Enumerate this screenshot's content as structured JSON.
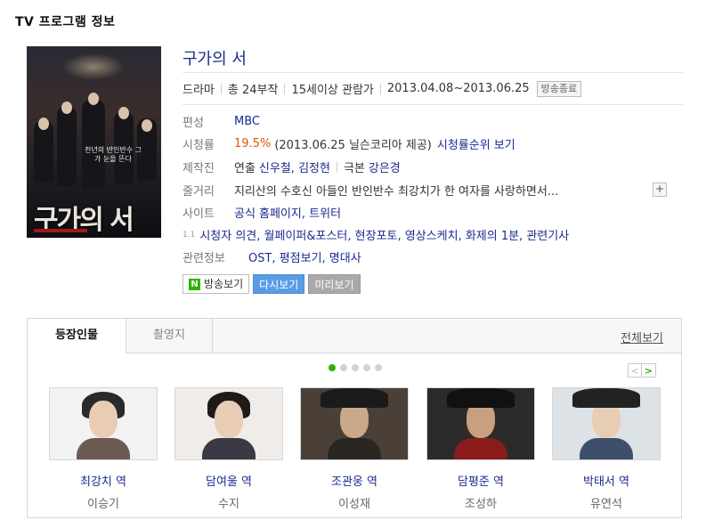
{
  "section_title": "TV 프로그램 정보",
  "poster": {
    "tagline": "천년의 반인반수 그가 눈을 뜬다",
    "title": "구가의 서"
  },
  "program": {
    "title": "구가의 서",
    "genre": "드라마",
    "episodes": "총 24부작",
    "rating": "15세이상 관람가",
    "period": "2013.04.08~2013.06.25",
    "status": "방송종료"
  },
  "info": {
    "channel_label": "편성",
    "channel": "MBC",
    "viewership_label": "시청률",
    "viewership_value": "19.5%",
    "viewership_note": "(2013.06.25 닐슨코리아 제공)",
    "viewership_link": "시청률순위 보기",
    "staff_label": "제작진",
    "director_prefix": "연출",
    "directors": "신우철, 김정현",
    "writer_prefix": "극본",
    "writer": "강은경",
    "synopsis_label": "줄거리",
    "synopsis": "지리산의 수호신 아들인 반인반수 최강치가 한 여자를 사랑하면서...",
    "site_label": "사이트",
    "site_links": "공식 홈페이지, 트위터",
    "extra_marker": "1.1",
    "extra_links": "시청자 의견, 월페이퍼&포스터, 현장포토, 영상스케치, 화제의 1분, 관련기사",
    "related_label": "관련정보",
    "related_links": "OST, 평점보기, 명대사"
  },
  "buttons": {
    "broadcast": "방송보기",
    "broadcast_logo": "N",
    "replay": "다시보기",
    "preview": "미리보기"
  },
  "cast_section": {
    "tabs": [
      "등장인물",
      "촬영지"
    ],
    "view_all": "전체보기",
    "pages": 5,
    "current_page": 1,
    "prev": "<",
    "next": ">",
    "members": [
      {
        "role": "최강치 역",
        "actor": "이승기"
      },
      {
        "role": "담여울 역",
        "actor": "수지"
      },
      {
        "role": "조관웅 역",
        "actor": "이성재"
      },
      {
        "role": "담평준 역",
        "actor": "조성하"
      },
      {
        "role": "박태서 역",
        "actor": "유연석"
      }
    ]
  }
}
